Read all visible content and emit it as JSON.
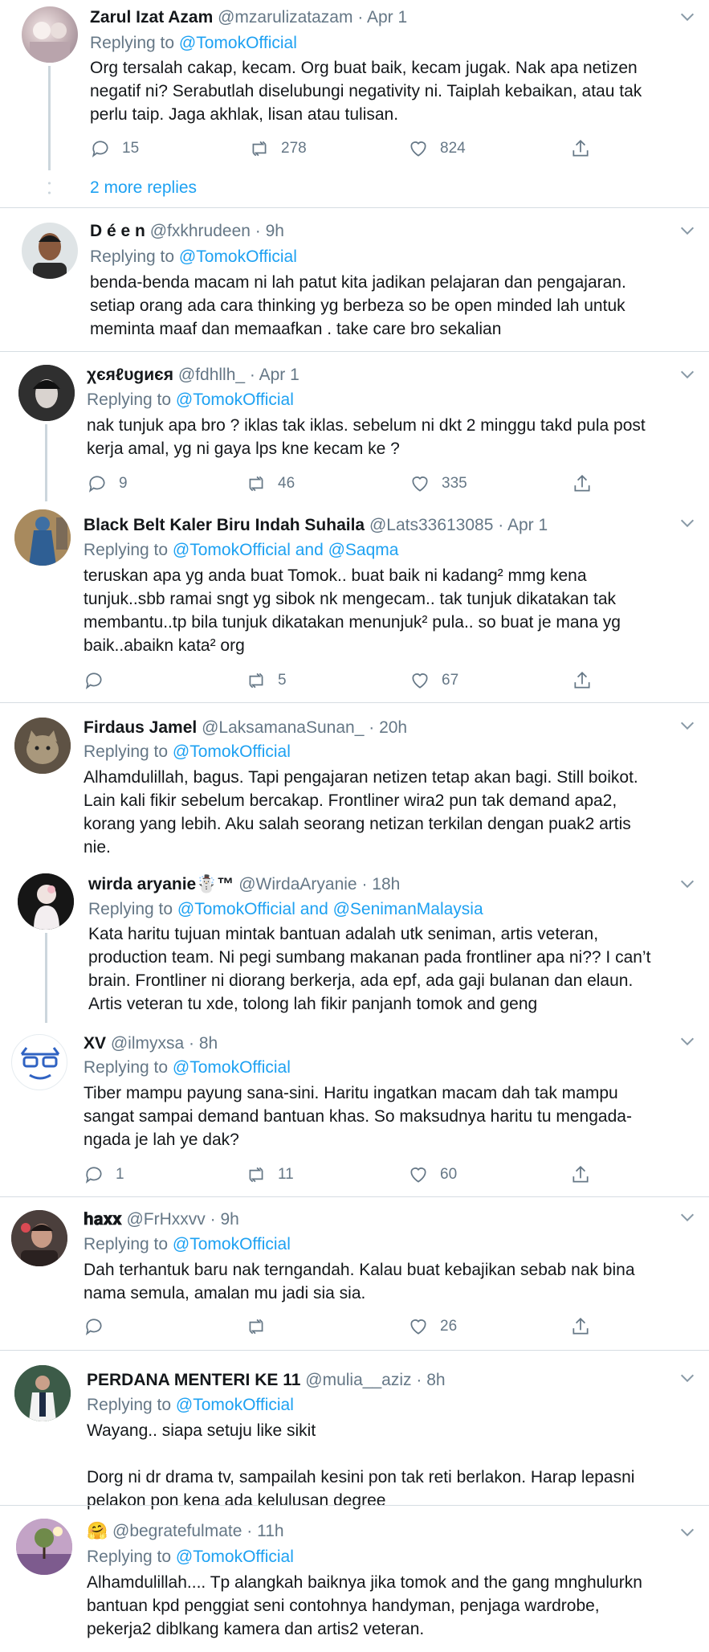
{
  "replying_label": "Replying to",
  "more_replies": "2 more replies",
  "tweets": [
    {
      "name": "Zarul Izat Azam",
      "handle": "@mzarulizatazam",
      "dot": "·",
      "time": "Apr 1",
      "reply_to": "@TomokOfficial",
      "lines": [
        "Org tersalah cakap, kecam. Org buat baik, kecam jugak. Nak apa netizen",
        "negatif ni? Serabutlah diselubungi negativity ni. Taiplah kebaikan, atau tak",
        "perlu taip. Jaga akhlak, lisan atau tulisan."
      ],
      "replies": "15",
      "retweets": "278",
      "likes": "824"
    },
    {
      "name": "D é e n",
      "handle": "@fxkhrudeen",
      "dot": "·",
      "time": "9h",
      "reply_to": "@TomokOfficial",
      "lines": [
        "benda-benda macam ni lah patut kita jadikan pelajaran dan pengajaran.",
        "setiap orang ada cara thinking yg berbeza so be open minded lah untuk",
        "meminta maaf dan memaafkan . take care bro sekalian"
      ]
    },
    {
      "name": "χєяℓυgиєя",
      "handle": "@fdhllh_",
      "dot": "·",
      "time": "Apr 1",
      "reply_to": "@TomokOfficial",
      "lines": [
        "nak tunjuk apa bro ? iklas tak iklas. sebelum ni dkt 2 minggu takd pula post",
        "kerja amal, yg ni gaya lps kne kecam ke ?"
      ],
      "replies": "9",
      "retweets": "46",
      "likes": "335"
    },
    {
      "name": "Black Belt Kaler Biru Indah Suhaila",
      "handle": "@Lats33613085",
      "dot": "·",
      "time": "Apr 1",
      "reply_to": "@TomokOfficial and @Saqma",
      "lines": [
        "teruskan apa yg anda buat Tomok.. buat baik ni kadang² mmg kena",
        "tunjuk..sbb ramai sngt yg sibok nk mengecam.. tak tunjuk dikatakan tak",
        "membantu..tp bila tunjuk dikatakan menunjuk² pula.. so buat je mana yg",
        "baik..abaikn kata² org"
      ],
      "replies": "",
      "retweets": "5",
      "likes": "67"
    },
    {
      "name": "Firdaus Jamel",
      "handle": "@LaksamanaSunan_",
      "dot": "·",
      "time": "20h",
      "reply_to": "@TomokOfficial",
      "lines": [
        "Alhamdulillah, bagus. Tapi pengajaran netizen tetap akan bagi. Still boikot.",
        "Lain kali fikir sebelum bercakap. Frontliner wira2 pun tak demand apa2,",
        "korang yang lebih. Aku salah seorang netizan terkilan dengan puak2 artis",
        "nie."
      ]
    },
    {
      "name": "wirda aryanie",
      "name_extra": "☃️™",
      "handle": "@WirdaAryanie",
      "dot": "·",
      "time": "18h",
      "reply_to": "@TomokOfficial and @SenimanMalaysia",
      "lines": [
        "Kata haritu tujuan mintak bantuan adalah utk seniman, artis veteran,",
        "production team. Ni pegi sumbang makanan pada frontliner apa ni?? I can’t",
        "brain. Frontliner ni diorang berkerja, ada epf, ada gaji bulanan dan elaun.",
        "Artis veteran tu xde, tolong lah fikir panjanh tomok and geng"
      ]
    },
    {
      "name": "XV",
      "handle": "@ilmyxsa",
      "dot": "·",
      "time": "8h",
      "reply_to": "@TomokOfficial",
      "lines": [
        "Tiber mampu payung sana-sini. Haritu ingatkan macam dah tak mampu",
        "sangat sampai demand bantuan khas. So maksudnya haritu tu mengada-",
        "ngada je lah ye dak?"
      ],
      "replies": "1",
      "retweets": "11",
      "likes": "60"
    },
    {
      "name": "𝐡𝐚𝐱𝐱",
      "handle": "@FrHxxvv",
      "dot": "·",
      "time": "9h",
      "reply_to": "@TomokOfficial",
      "lines": [
        "Dah terhantuk baru nak terngandah. Kalau buat kebajikan sebab nak bina",
        "nama semula, amalan mu jadi sia sia."
      ],
      "replies": "",
      "retweets": "",
      "likes": "26"
    },
    {
      "name": "PERDANA MENTERI KE 11",
      "handle": "@mulia__aziz",
      "dot": "·",
      "time": "8h",
      "reply_to": "@TomokOfficial",
      "lines": [
        "Wayang.. siapa setuju like sikit",
        "",
        "Dorg ni dr drama tv, sampailah kesini pon tak reti berlakon. Harap lepasni",
        "pelakon pon kena ada kelulusan degree"
      ]
    },
    {
      "name": "🤗",
      "handle": "@begratefulmate",
      "dot": "·",
      "time": "11h",
      "reply_to": "@TomokOfficial",
      "lines": [
        "Alhamdulillah.... Tp alangkah baiknya jika tomok and the gang mnghulurkn",
        "bantuan kpd penggiat seni contohnya handyman, penjaga wardrobe,",
        "pekerja2 diblkang kamera dan artis2 veteran."
      ]
    }
  ],
  "colors": {
    "link": "#1da1f2",
    "muted": "#657786",
    "text": "#14171a",
    "divider": "#e6ecf0"
  }
}
